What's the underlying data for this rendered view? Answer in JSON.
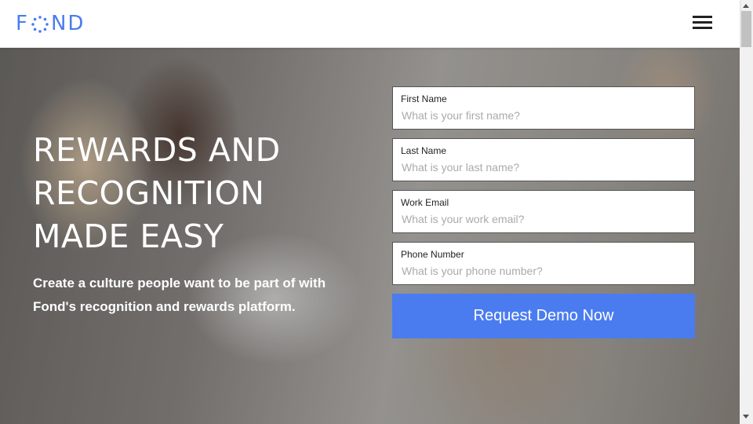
{
  "header": {
    "logo_text_f": "F",
    "logo_text_nd": "ND",
    "menu_icon": "hamburger-icon"
  },
  "hero": {
    "title_line1": "REWARDS AND",
    "title_line2": "RECOGNITION",
    "title_line3": "MADE EASY",
    "subtitle_line1": "Create a culture people want to be part of with",
    "subtitle_line2": "Fond's recognition and rewards platform."
  },
  "form": {
    "fields": [
      {
        "label": "First Name",
        "placeholder": "What is your first name?",
        "value": ""
      },
      {
        "label": "Last Name",
        "placeholder": "What is your last name?",
        "value": ""
      },
      {
        "label": "Work Email",
        "placeholder": "What is your work email?",
        "value": ""
      },
      {
        "label": "Phone Number",
        "placeholder": "What is your phone number?",
        "value": ""
      }
    ],
    "submit_label": "Request Demo Now"
  },
  "colors": {
    "brand": "#4a7cf0",
    "text_dark": "#222222"
  }
}
